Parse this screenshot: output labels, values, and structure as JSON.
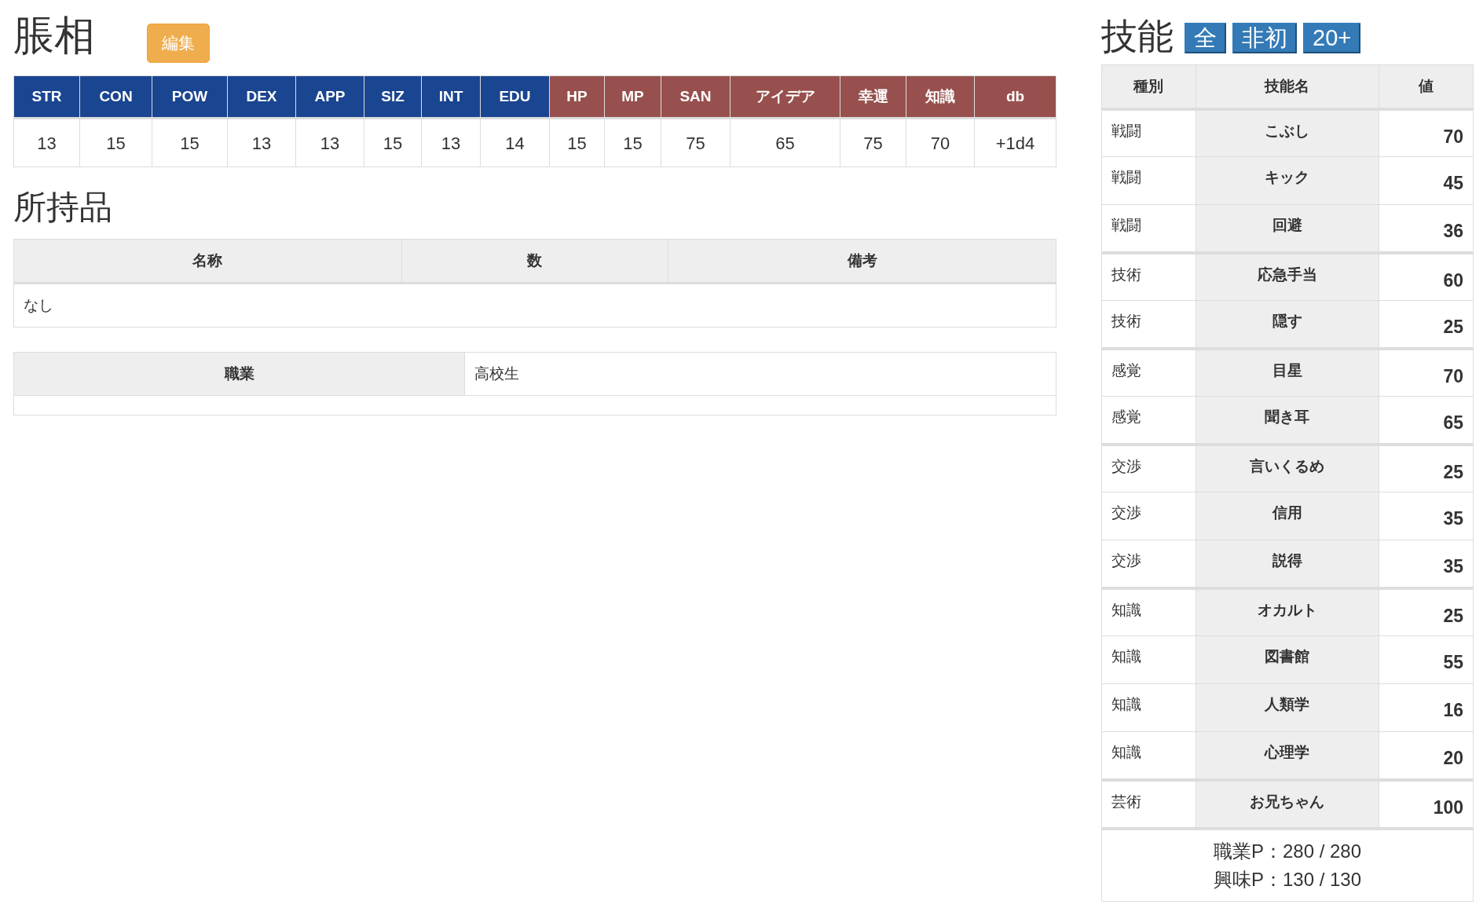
{
  "character": {
    "name": "脹相",
    "edit_button": "編集"
  },
  "stats": [
    {
      "label": "STR",
      "value": "13",
      "kind": "base"
    },
    {
      "label": "CON",
      "value": "15",
      "kind": "base"
    },
    {
      "label": "POW",
      "value": "15",
      "kind": "base"
    },
    {
      "label": "DEX",
      "value": "13",
      "kind": "base"
    },
    {
      "label": "APP",
      "value": "13",
      "kind": "base"
    },
    {
      "label": "SIZ",
      "value": "15",
      "kind": "base"
    },
    {
      "label": "INT",
      "value": "13",
      "kind": "base"
    },
    {
      "label": "EDU",
      "value": "14",
      "kind": "base"
    },
    {
      "label": "HP",
      "value": "15",
      "kind": "derived"
    },
    {
      "label": "MP",
      "value": "15",
      "kind": "derived"
    },
    {
      "label": "SAN",
      "value": "75",
      "kind": "derived"
    },
    {
      "label": "アイデア",
      "value": "65",
      "kind": "derived"
    },
    {
      "label": "幸運",
      "value": "75",
      "kind": "derived"
    },
    {
      "label": "知識",
      "value": "70",
      "kind": "derived"
    },
    {
      "label": "db",
      "value": "+1d4",
      "kind": "derived"
    }
  ],
  "items": {
    "title": "所持品",
    "columns": [
      "名称",
      "数",
      "備考"
    ],
    "empty_text": "なし"
  },
  "occupation": {
    "label": "職業",
    "value": "高校生"
  },
  "skills": {
    "title": "技能",
    "filters": [
      "全",
      "非初",
      "20+"
    ],
    "columns": [
      "種別",
      "技能名",
      "値"
    ],
    "rows": [
      {
        "category": "戦闘",
        "name": "こぶし",
        "value": "70"
      },
      {
        "category": "戦闘",
        "name": "キック",
        "value": "45"
      },
      {
        "category": "戦闘",
        "name": "回避",
        "value": "36"
      },
      {
        "category": "技術",
        "name": "応急手当",
        "value": "60"
      },
      {
        "category": "技術",
        "name": "隠す",
        "value": "25"
      },
      {
        "category": "感覚",
        "name": "目星",
        "value": "70"
      },
      {
        "category": "感覚",
        "name": "聞き耳",
        "value": "65"
      },
      {
        "category": "交渉",
        "name": "言いくるめ",
        "value": "25"
      },
      {
        "category": "交渉",
        "name": "信用",
        "value": "35"
      },
      {
        "category": "交渉",
        "name": "説得",
        "value": "35"
      },
      {
        "category": "知識",
        "name": "オカルト",
        "value": "25"
      },
      {
        "category": "知識",
        "name": "図書館",
        "value": "55"
      },
      {
        "category": "知識",
        "name": "人類学",
        "value": "16"
      },
      {
        "category": "知識",
        "name": "心理学",
        "value": "20"
      },
      {
        "category": "芸術",
        "name": "お兄ちゃん",
        "value": "100"
      }
    ],
    "points": [
      "職業P：280 / 280",
      "興味P：130 / 130"
    ]
  }
}
